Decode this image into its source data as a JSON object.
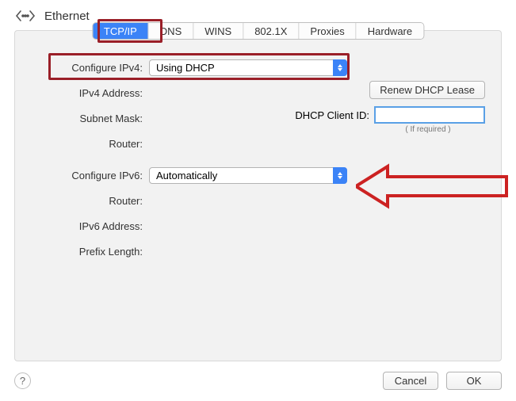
{
  "header": {
    "title": "Ethernet"
  },
  "tabs": {
    "t0": "TCP/IP",
    "t1": "DNS",
    "t2": "WINS",
    "t3": "802.1X",
    "t4": "Proxies",
    "t5": "Hardware"
  },
  "labels": {
    "configure_ipv4": "Configure IPv4:",
    "ipv4_address": "IPv4 Address:",
    "subnet_mask": "Subnet Mask:",
    "router_v4": "Router:",
    "configure_ipv6": "Configure IPv6:",
    "router_v6": "Router:",
    "ipv6_address": "IPv6 Address:",
    "prefix_length": "Prefix Length:",
    "dhcp_client_id": "DHCP Client ID:",
    "if_required": "( If required )"
  },
  "values": {
    "ipv4_mode": "Using DHCP",
    "ipv6_mode": "Automatically",
    "dhcp_client_id": ""
  },
  "buttons": {
    "renew": "Renew DHCP Lease",
    "cancel": "Cancel",
    "ok": "OK",
    "help": "?"
  }
}
